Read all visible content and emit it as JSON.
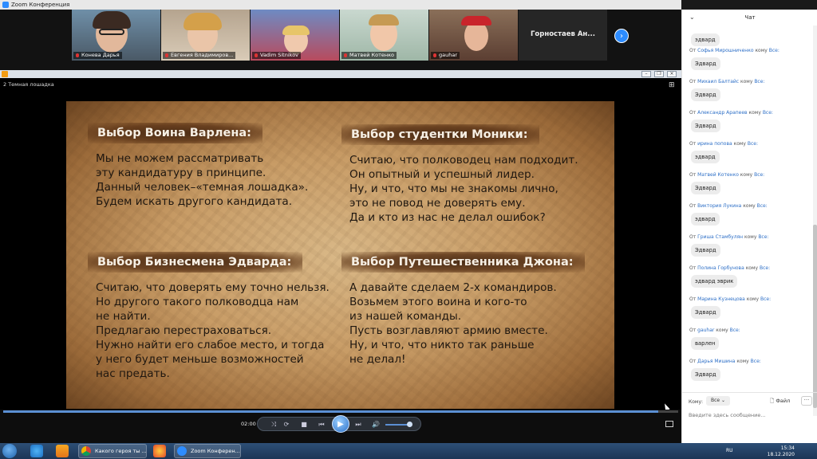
{
  "window": {
    "title": "Zoom Конференция"
  },
  "participants": [
    {
      "name": "Конева Дарья"
    },
    {
      "name": "Евгения Владимиров..."
    },
    {
      "name": "Vadim Sitnikov"
    },
    {
      "name": "Матвей Котенко"
    },
    {
      "name": "gauhar"
    },
    {
      "name": "Горностаев Ан..."
    }
  ],
  "player": {
    "video_title": "2 Темная лошадка",
    "time": "02:00",
    "progress": 0.97,
    "volume": 0.85
  },
  "slide": {
    "blocks": [
      {
        "heading": "Выбор Воина Варлена:",
        "lines": [
          "Мы не можем рассматривать",
          "эту кандидатуру в принципе.",
          "Данный человек–«темная лошадка».",
          "Будем искать другого кандидата."
        ]
      },
      {
        "heading": "Выбор студентки Моники:",
        "lines": [
          "Считаю, что полководец нам подходит.",
          "Он  опытный и успешный лидер.",
          "Ну, и что, что мы не знакомы лично,",
          "это не повод не доверять ему.",
          "Да и кто из нас не делал ошибок?"
        ]
      },
      {
        "heading": "Выбор Бизнесмена Эдварда:",
        "lines": [
          "Считаю, что доверять ему точно нельзя.",
          "Но другого такого полководца нам",
          "не найти.",
          "Предлагаю перестраховаться.",
          "Нужно найти его слабое место, и тогда",
          "у него будет меньше возможностей",
          "нас предать."
        ]
      },
      {
        "heading": "Выбор Путешественника Джона:",
        "lines": [
          "А давайте сделаем 2-х командиров.",
          "Возьмем этого воина и кого-то",
          "из нашей команды.",
          "Пусть возглавляют армию вместе.",
          "Ну, и что, что никто так раньше",
          "не делал!"
        ]
      }
    ]
  },
  "chat": {
    "title": "Чат",
    "first_message": "эдвард",
    "messages": [
      {
        "from_prefix": "От",
        "sender": "Софья Мирошниченко",
        "to_prefix": "кому",
        "recipient": "Все:",
        "text": "Эдвард"
      },
      {
        "from_prefix": "От",
        "sender": "Михаил Балтайс",
        "to_prefix": "кому",
        "recipient": "Все:",
        "text": "Эдвард"
      },
      {
        "from_prefix": "От",
        "sender": "Александр Арапеев",
        "to_prefix": "кому",
        "recipient": "Все:",
        "text": "Эдвард"
      },
      {
        "from_prefix": "От",
        "sender": "ирина попова",
        "to_prefix": "кому",
        "recipient": "Все:",
        "text": "эдвард"
      },
      {
        "from_prefix": "От",
        "sender": "Матвей Котенко",
        "to_prefix": "кому",
        "recipient": "Все:",
        "text": "Эдвард"
      },
      {
        "from_prefix": "От",
        "sender": "Виктория Лукина",
        "to_prefix": "кому",
        "recipient": "Все:",
        "text": "эдвард"
      },
      {
        "from_prefix": "От",
        "sender": "Гриша Стамбулян",
        "to_prefix": "кому",
        "recipient": "Все:",
        "text": "Эдвард"
      },
      {
        "from_prefix": "От",
        "sender": "Полина Горбунова",
        "to_prefix": "кому",
        "recipient": "Все:",
        "text": "эдвард эврик"
      },
      {
        "from_prefix": "От",
        "sender": "Марина Кузнецова",
        "to_prefix": "кому",
        "recipient": "Все:",
        "text": "Эдвард"
      },
      {
        "from_prefix": "От",
        "sender": "gauhar",
        "to_prefix": "кому",
        "recipient": "Все:",
        "text": "варлен"
      },
      {
        "from_prefix": "От",
        "sender": "Дарья Мишина",
        "to_prefix": "кому",
        "recipient": "Все:",
        "text": "Эдвард"
      }
    ],
    "to_label": "Кому:",
    "to_value": "Все",
    "file_label": "Файл",
    "more_label": "···",
    "input_placeholder": "Введите здесь сообщение..."
  },
  "taskbar": {
    "tasks": [
      {
        "label": "Какого героя ты ..."
      },
      {
        "label": "Zoom Конферен..."
      }
    ],
    "lang": "RU",
    "clock_time": "15:34",
    "clock_date": "18.12.2020"
  },
  "colors": {
    "zoom_blue": "#2d8cff",
    "chat_link": "#2d6fc7"
  }
}
